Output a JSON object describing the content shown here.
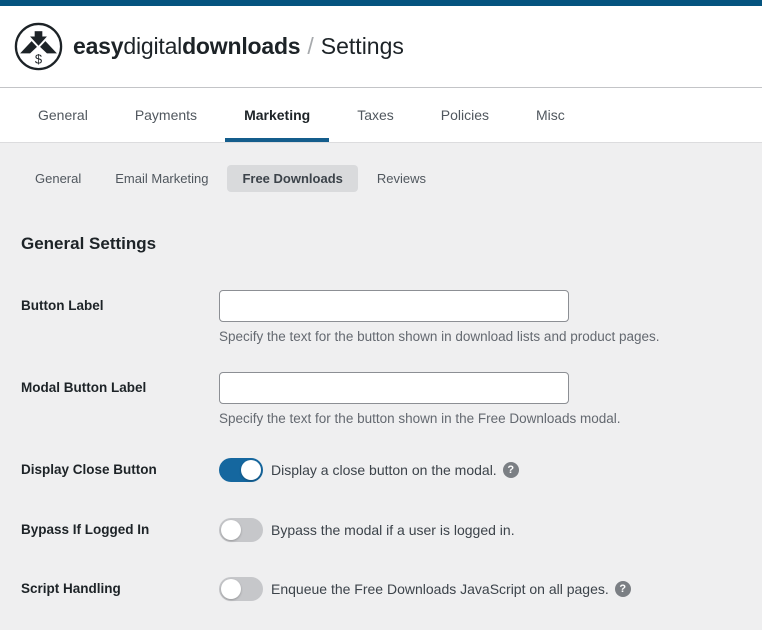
{
  "colors": {
    "admin_bar": "#05547f",
    "tab_underline": "#145d8c",
    "toggle_on": "#15679f",
    "toggle_off": "#c6c7ca",
    "content_bg": "#efeff0",
    "active_subtab_bg": "#d9dadc"
  },
  "header": {
    "brand_easy": "easy",
    "brand_digital": "digital",
    "brand_downloads": "downloads",
    "separator": "/",
    "page": "Settings"
  },
  "tabs": [
    {
      "label": "General",
      "active": false
    },
    {
      "label": "Payments",
      "active": false
    },
    {
      "label": "Marketing",
      "active": true
    },
    {
      "label": "Taxes",
      "active": false
    },
    {
      "label": "Policies",
      "active": false
    },
    {
      "label": "Misc",
      "active": false
    }
  ],
  "subtabs": [
    {
      "label": "General",
      "active": false
    },
    {
      "label": "Email Marketing",
      "active": false
    },
    {
      "label": "Free Downloads",
      "active": true
    },
    {
      "label": "Reviews",
      "active": false
    }
  ],
  "section": {
    "title": "General Settings"
  },
  "settings": {
    "rows": [
      {
        "type": "text",
        "label": "Button Label",
        "value": "",
        "description": "Specify the text for the button shown in download lists and product pages."
      },
      {
        "type": "text",
        "label": "Modal Button Label",
        "value": "",
        "description": "Specify the text for the button shown in the Free Downloads modal."
      },
      {
        "type": "toggle",
        "label": "Display Close Button",
        "on": true,
        "description": "Display a close button on the modal.",
        "has_help": true
      },
      {
        "type": "toggle",
        "label": "Bypass If Logged In",
        "on": false,
        "description": "Bypass the modal if a user is logged in.",
        "has_help": false
      },
      {
        "type": "toggle",
        "label": "Script Handling",
        "on": false,
        "description": "Enqueue the Free Downloads JavaScript on all pages.",
        "has_help": true
      }
    ]
  },
  "icons": {
    "help": "?"
  }
}
